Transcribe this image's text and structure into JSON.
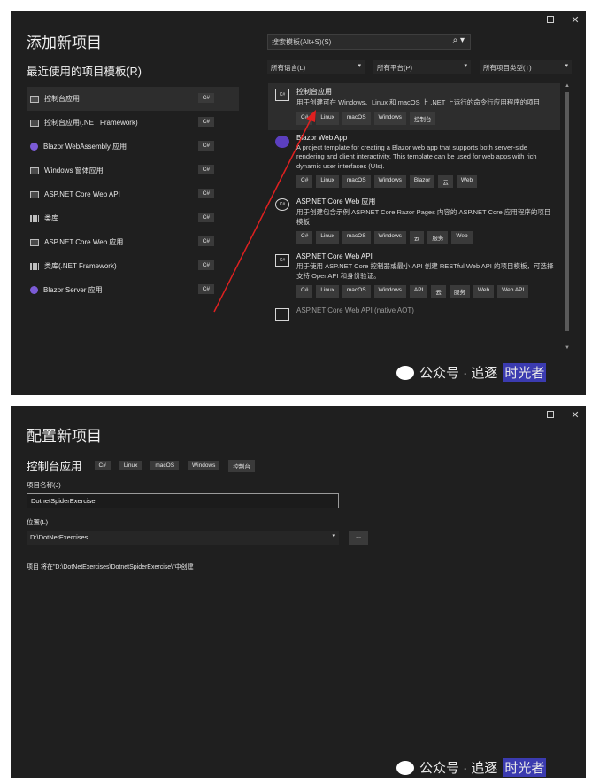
{
  "window1": {
    "controls": [
      "□",
      "✕"
    ],
    "title": "添加新项目",
    "recent_header": "最近使用的项目模板(R)",
    "search_placeholder": "搜索模板(Alt+S)(S)",
    "search_icon": "search-icon",
    "filters": [
      "所有语言(L)",
      "所有平台(P)",
      "所有项目类型(T)"
    ],
    "recent": [
      {
        "label": "控制台应用",
        "lang": "C#",
        "icon": "console-icon"
      },
      {
        "label": "控制台应用(.NET Framework)",
        "lang": "C#",
        "icon": "console-icon"
      },
      {
        "label": "Blazor WebAssembly 应用",
        "lang": "C#",
        "icon": "blazor-icon"
      },
      {
        "label": "Windows 窗体应用",
        "lang": "C#",
        "icon": "window-icon"
      },
      {
        "label": "ASP.NET Core Web API",
        "lang": "C#",
        "icon": "api-icon"
      },
      {
        "label": "类库",
        "lang": "C#",
        "icon": "library-icon"
      },
      {
        "label": "ASP.NET Core Web 应用",
        "lang": "C#",
        "icon": "web-icon"
      },
      {
        "label": "类库(.NET Framework)",
        "lang": "C#",
        "icon": "library-icon"
      },
      {
        "label": "Blazor Server 应用",
        "lang": "C#",
        "icon": "blazor-icon"
      }
    ],
    "templates": [
      {
        "title": "控制台应用",
        "desc": "用于创建可在 Windows、Linux 和 macOS 上 .NET 上运行的命令行应用程序的项目",
        "tags": [
          "C#",
          "Linux",
          "macOS",
          "Windows",
          "控制台"
        ],
        "icon_text": "C#"
      },
      {
        "title": "Blazor Web App",
        "desc": "A project template for creating a Blazor web app that supports both server-side rendering and client interactivity. This template can be used for web apps with rich dynamic user interfaces (UIs).",
        "tags": [
          "C#",
          "Linux",
          "macOS",
          "Windows",
          "Blazor",
          "云",
          "Web"
        ],
        "icon_text": ""
      },
      {
        "title": "ASP.NET Core Web 应用",
        "desc": "用于创建包含示例 ASP.NET Core Razor Pages 内容的 ASP.NET Core 应用程序的项目模板",
        "tags": [
          "C#",
          "Linux",
          "macOS",
          "Windows",
          "云",
          "服务",
          "Web"
        ],
        "icon_text": "C#"
      },
      {
        "title": "ASP.NET Core Web API",
        "desc": "用于使用 ASP.NET Core 控制器或最小 API 创建 RESTful Web API 的项目模板，可选择支持 OpenAPI 和身份验证。",
        "tags": [
          "C#",
          "Linux",
          "macOS",
          "Windows",
          "API",
          "云",
          "服务",
          "Web",
          "Web API"
        ],
        "icon_text": "C#"
      },
      {
        "title": "ASP.NET Core Web API (native AOT)",
        "desc": "",
        "tags": [],
        "icon_text": ""
      }
    ]
  },
  "window2": {
    "controls": [
      "□",
      "✕"
    ],
    "title": "配置新项目",
    "template_name": "控制台应用",
    "tags": [
      "C#",
      "Linux",
      "macOS",
      "Windows",
      "控制台"
    ],
    "project_name_label": "项目名称(J)",
    "project_name_value": "DotnetSpiderExercise",
    "location_label": "位置(L)",
    "location_value": "D:\\DotNetExercises",
    "browse_label": "...",
    "hint": "项目 将在\"D:\\DotNetExercises\\DotnetSpiderExercise\\\"中创建"
  },
  "watermark": {
    "text": "公众号 · 追逐",
    "highlight": "时光者"
  },
  "colors": {
    "window_bg": "#1f1f1f",
    "selected_bg": "#2d2d2d",
    "tag_bg": "#3a3a3a",
    "arrow": "#e02020",
    "blazor": "#7b5bd6"
  }
}
